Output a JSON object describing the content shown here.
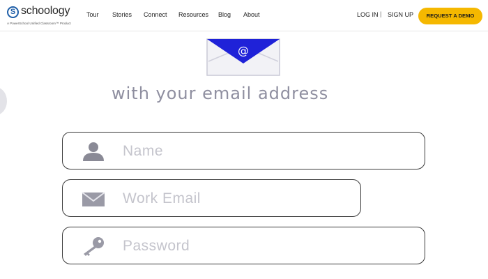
{
  "brand": {
    "name": "schoology",
    "mark": "S",
    "tagline": "A PowerSchool Unified Classroom™ Product",
    "color": "#1f5fa8"
  },
  "nav": {
    "items": [
      {
        "label": "Tour"
      },
      {
        "label": "Stories"
      },
      {
        "label": "Connect"
      },
      {
        "label": "Resources"
      },
      {
        "label": "Blog"
      },
      {
        "label": "About"
      }
    ]
  },
  "auth": {
    "login_label": "LOG IN",
    "separator": "|",
    "signup_label": "SIGN UP",
    "demo_label": "REQUEST A DEMO",
    "demo_color": "#f5b800"
  },
  "signup": {
    "headline": "with your email address",
    "email_symbol": "@",
    "fields": {
      "name": {
        "placeholder": "Name",
        "icon": "user-icon",
        "value": ""
      },
      "email": {
        "placeholder": "Work Email",
        "icon": "envelope-icon",
        "value": ""
      },
      "password": {
        "placeholder": "Password",
        "icon": "key-icon",
        "value": ""
      }
    }
  }
}
